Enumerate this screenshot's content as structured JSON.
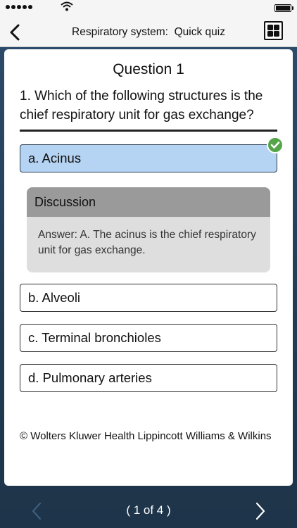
{
  "nav": {
    "title": "Respiratory system:  Quick quiz",
    "back_icon": "chevron-left-icon",
    "grid_icon": "grid-view-icon"
  },
  "question": {
    "heading": "Question 1",
    "text": "1. Which of the following structures is the chief respiratory unit for gas exchange?"
  },
  "options": [
    {
      "label": "a. Acinus",
      "selected": true,
      "correct": true
    },
    {
      "label": "b. Alveoli",
      "selected": false
    },
    {
      "label": "c. Terminal bronchioles",
      "selected": false
    },
    {
      "label": "d. Pulmonary arteries",
      "selected": false
    }
  ],
  "discussion": {
    "title": "Discussion",
    "body": "Answer: A. The acinus is the chief respiratory unit for gas exchange."
  },
  "copyright": "© Wolters Kluwer Health Lippincott Williams & Wilkins",
  "pager": {
    "indicator": "( 1 of 4 )",
    "prev_icon": "chevron-left-icon",
    "next_icon": "chevron-right-icon"
  },
  "colors": {
    "selected_option": "#b5d3f2",
    "correct_check": "#54a449",
    "background": "#24405b"
  }
}
